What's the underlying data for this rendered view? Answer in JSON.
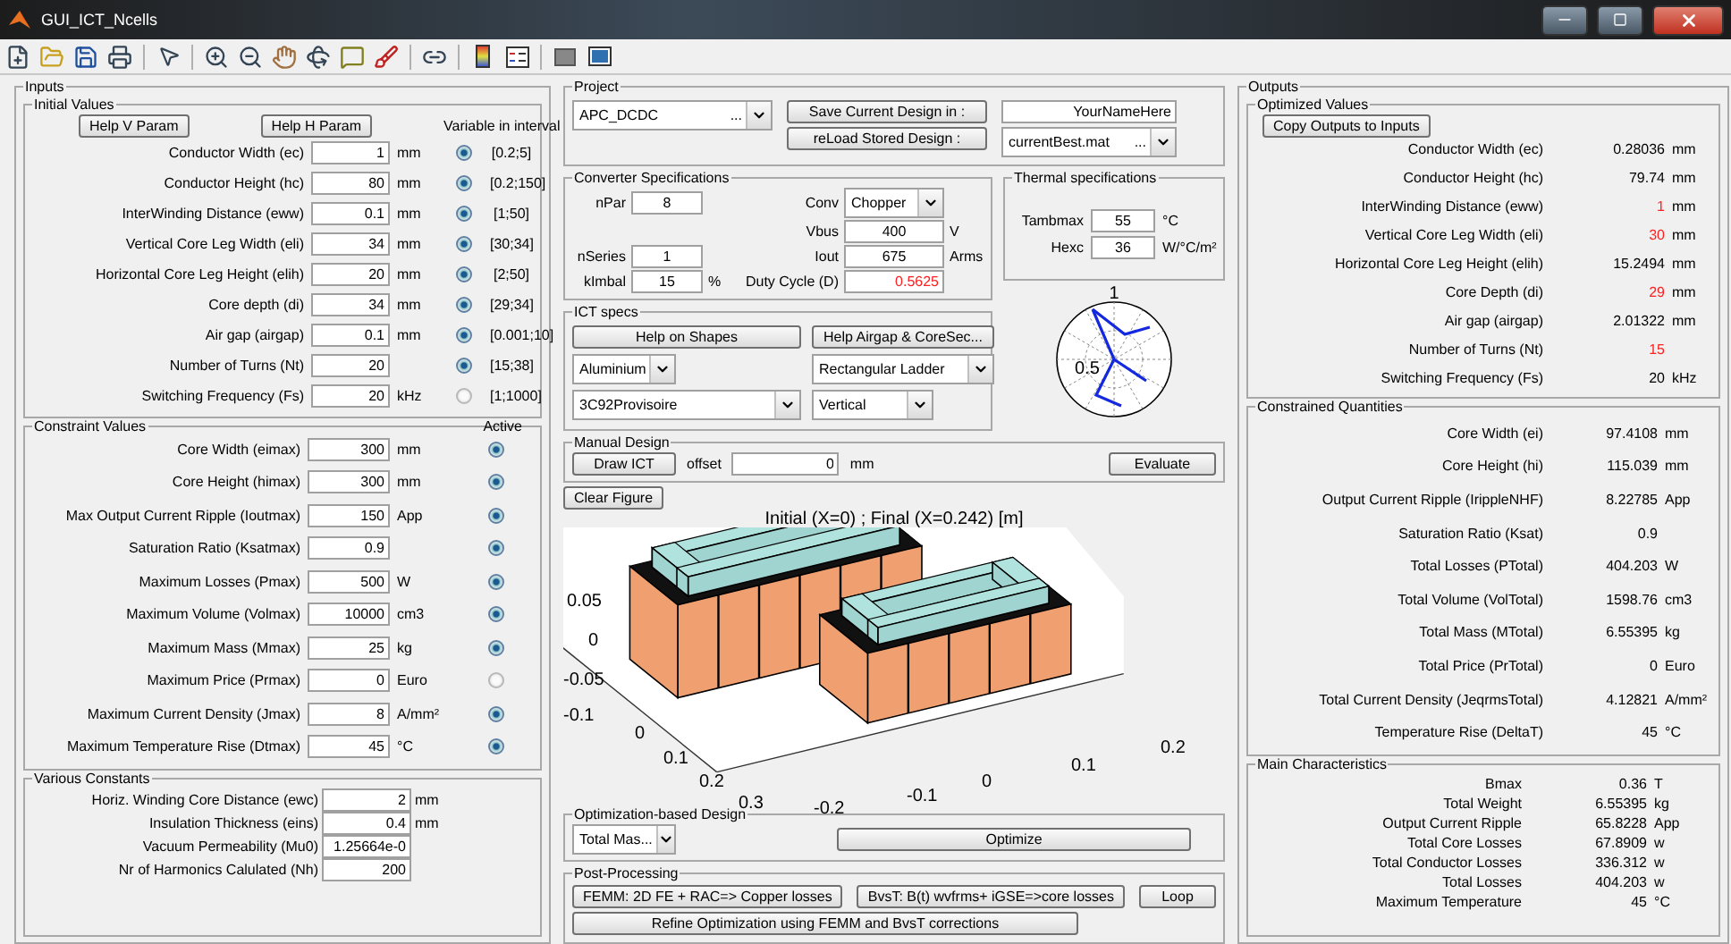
{
  "window": {
    "title": "GUI_ICT_Ncells"
  },
  "inputs": {
    "title": "Inputs",
    "initial_values": {
      "title": "Initial Values",
      "help_buttons": [
        "Help V Param",
        "Help H Param"
      ],
      "column_header": "Variable in interval",
      "rows": [
        {
          "label": "Conductor Width (ec)",
          "value": "1",
          "unit": "mm",
          "variable": true,
          "interval": "[0.2;5]"
        },
        {
          "label": "Conductor Height (hc)",
          "value": "80",
          "unit": "mm",
          "variable": true,
          "interval": "[0.2;150]"
        },
        {
          "label": "InterWinding Distance (eww)",
          "value": "0.1",
          "unit": "mm",
          "variable": true,
          "interval": "[1;50]"
        },
        {
          "label": "Vertical Core Leg Width (eli)",
          "value": "34",
          "unit": "mm",
          "variable": true,
          "interval": "[30;34]"
        },
        {
          "label": "Horizontal Core Leg Height (elih)",
          "value": "20",
          "unit": "mm",
          "variable": true,
          "interval": "[2;50]"
        },
        {
          "label": "Core depth (di)",
          "value": "34",
          "unit": "mm",
          "variable": true,
          "interval": "[29;34]"
        },
        {
          "label": "Air gap (airgap)",
          "value": "0.1",
          "unit": "mm",
          "variable": true,
          "interval": "[0.001;10]"
        },
        {
          "label": "Number of Turns (Nt)",
          "value": "20",
          "variable": true,
          "interval": "[15;38]"
        },
        {
          "label": "Switching Frequency (Fs)",
          "value": "20",
          "unit": "kHz",
          "variable": false,
          "interval": "[1;1000]"
        }
      ]
    },
    "constraint_values": {
      "title": "Constraint Values",
      "column_header": "Active",
      "rows": [
        {
          "label": "Core Width (eimax)",
          "value": "300",
          "unit": "mm",
          "active": true
        },
        {
          "label": "Core Height (himax)",
          "value": "300",
          "unit": "mm",
          "active": true
        },
        {
          "label": "Max Output Current Ripple (Ioutmax)",
          "value": "150",
          "unit": "App",
          "active": true
        },
        {
          "label": "Saturation Ratio (Ksatmax)",
          "value": "0.9",
          "active": true
        },
        {
          "label": "Maximum Losses (Pmax)",
          "value": "500",
          "unit": "W",
          "active": true
        },
        {
          "label": "Maximum Volume (Volmax)",
          "value": "10000",
          "unit": "cm3",
          "active": true
        },
        {
          "label": "Maximum Mass (Mmax)",
          "value": "25",
          "unit": "kg",
          "active": true
        },
        {
          "label": "Maximum Price (Prmax)",
          "value": "0",
          "unit": "Euro",
          "active": false
        },
        {
          "label": "Maximum Current Density (Jmax)",
          "value": "8",
          "unit": "A/mm²",
          "active": true
        },
        {
          "label": "Maximum Temperature Rise (Dtmax)",
          "value": "45",
          "unit": "°C",
          "active": true
        }
      ]
    },
    "various_constants": {
      "title": "Various Constants",
      "rows": [
        {
          "label": "Horiz. Winding Core Distance (ewc)",
          "value": "2",
          "unit": "mm"
        },
        {
          "label": "Insulation Thickness (eins)",
          "value": "0.4",
          "unit": "mm"
        },
        {
          "label": "Vacuum Permeability (Mu0)",
          "value": "1.25664e-0"
        },
        {
          "label": "Nr of Harmonics Calulated (Nh)",
          "value": "200"
        }
      ]
    }
  },
  "project": {
    "title": "Project",
    "project_select": "APC_DCDC",
    "project_select_more": "...",
    "save_button": "Save Current Design in :",
    "reload_button": "reLoad Stored Design :",
    "name_field": "YourNameHere",
    "file_select": "currentBest.mat",
    "file_select_more": "..."
  },
  "converter": {
    "title": "Converter Specifications",
    "rows": [
      {
        "left": {
          "label": "nPar",
          "value": "8"
        },
        "right": {
          "kind": "select",
          "label": "Conv",
          "value": "Chopper"
        }
      },
      {
        "right": {
          "kind": "input",
          "label": "Vbus",
          "value": "400",
          "unit": "V"
        }
      },
      {
        "left": {
          "label": "nSeries",
          "value": "1"
        },
        "right": {
          "kind": "input",
          "label": "Iout",
          "value": "675",
          "unit": "Arms"
        }
      },
      {
        "left": {
          "label": "kImbal",
          "value": "15",
          "unit": "%"
        },
        "right": {
          "kind": "computed",
          "label": "Duty Cycle (D)",
          "value": "0.5625"
        }
      }
    ]
  },
  "thermal": {
    "title": "Thermal specifications",
    "fields": [
      {
        "label": "Tambmax",
        "value": "55",
        "unit": "°C"
      },
      {
        "label": "Hexc",
        "value": "36",
        "unit": "W/°C/m²"
      }
    ],
    "polar_labels": [
      "1",
      "0.5"
    ]
  },
  "ict_specs": {
    "title": "ICT specs",
    "help_buttons": [
      "Help on Shapes",
      "Help Airgap & CoreSec..."
    ],
    "selects": [
      "Aluminium",
      "Rectangular Ladder",
      "3C92Provisoire",
      "Vertical"
    ]
  },
  "manual_design": {
    "title": "Manual Design",
    "draw_button": "Draw ICT",
    "offset_label": "offset",
    "offset_value": "0",
    "offset_unit": "mm",
    "evaluate_button": "Evaluate",
    "clear_button": "Clear Figure"
  },
  "plot": {
    "title": "Initial (X=0) ; Final (X=0.242) [m]",
    "z_ticks": [
      "0.05",
      "0",
      "-0.05",
      "-0.1"
    ],
    "y_ticks": [
      "0",
      "0.1",
      "0.2",
      "0.3"
    ],
    "x_ticks": [
      "-0.2",
      "-0.1",
      "0",
      "0.1",
      "0.2"
    ]
  },
  "optimization": {
    "title": "Optimization-based Design",
    "objective_select": "Total Mas...",
    "optimize_button": "Optimize"
  },
  "post_processing": {
    "title": "Post-Processing",
    "buttons": [
      "FEMM: 2D FE +  RAC=> Copper losses",
      "BvsT: B(t) wvfrms+ iGSE=>core losses",
      "Loop"
    ],
    "refine_button": "Refine Optimization using FEMM and BvsT corrections"
  },
  "outputs": {
    "title": "Outputs",
    "optimized_values": {
      "title": "Optimized Values",
      "copy_button": "Copy Outputs to Inputs",
      "rows": [
        {
          "label": "Conductor Width (ec)",
          "value": "0.28036",
          "unit": "mm",
          "at_bound": false
        },
        {
          "label": "Conductor Height (hc)",
          "value": "79.74",
          "unit": "mm",
          "at_bound": false
        },
        {
          "label": "InterWinding Distance (eww)",
          "value": "1",
          "unit": "mm",
          "at_bound": true
        },
        {
          "label": "Vertical Core Leg Width (eli)",
          "value": "30",
          "unit": "mm",
          "at_bound": true
        },
        {
          "label": "Horizontal Core Leg Height (elih)",
          "value": "15.2494",
          "unit": "mm",
          "at_bound": false
        },
        {
          "label": "Core Depth (di)",
          "value": "29",
          "unit": "mm",
          "at_bound": true
        },
        {
          "label": "Air gap (airgap)",
          "value": "2.01322",
          "unit": "mm",
          "at_bound": false
        },
        {
          "label": "Number of Turns (Nt)",
          "value": "15",
          "at_bound": true
        },
        {
          "label": "Switching Frequency (Fs)",
          "value": "20",
          "unit": "kHz",
          "at_bound": false
        }
      ]
    },
    "constrained_quantities": {
      "title": "Constrained Quantities",
      "rows": [
        {
          "label": "Core Width (ei)",
          "value": "97.4108",
          "unit": "mm"
        },
        {
          "label": "Core Height (hi)",
          "value": "115.039",
          "unit": "mm"
        },
        {
          "label": "Output Current Ripple (IrippleNHF)",
          "value": "8.22785",
          "unit": "App"
        },
        {
          "label": "Saturation Ratio (Ksat)",
          "value": "0.9"
        },
        {
          "label": "Total Losses (PTotal)",
          "value": "404.203",
          "unit": "W"
        },
        {
          "label": "Total Volume (VolTotal)",
          "value": "1598.76",
          "unit": "cm3"
        },
        {
          "label": "Total Mass (MTotal)",
          "value": "6.55395",
          "unit": "kg"
        },
        {
          "label": "Total Price (PrTotal)",
          "value": "0",
          "unit": "Euro"
        },
        {
          "label": "Total Current Density (JeqrmsTotal)",
          "value": "4.12821",
          "unit": "A/mm²"
        },
        {
          "label": "Temperature Rise (DeltaT)",
          "value": "45",
          "unit": "°C"
        }
      ]
    },
    "main_characteristics": {
      "title": "Main Characteristics",
      "rows": [
        {
          "label": "Bmax",
          "value": "0.36",
          "unit": "T"
        },
        {
          "label": "Total Weight",
          "value": "6.55395",
          "unit": "kg"
        },
        {
          "label": "Output Current Ripple",
          "value": "65.8228",
          "unit": "App"
        },
        {
          "label": "Total Core Losses",
          "value": "67.8909",
          "unit": "w"
        },
        {
          "label": "Total Conductor Losses",
          "value": "336.312",
          "unit": "w"
        },
        {
          "label": "Total Losses",
          "value": "404.203",
          "unit": "w"
        },
        {
          "label": "Maximum Temperature",
          "value": "45",
          "unit": "°C"
        }
      ]
    }
  }
}
